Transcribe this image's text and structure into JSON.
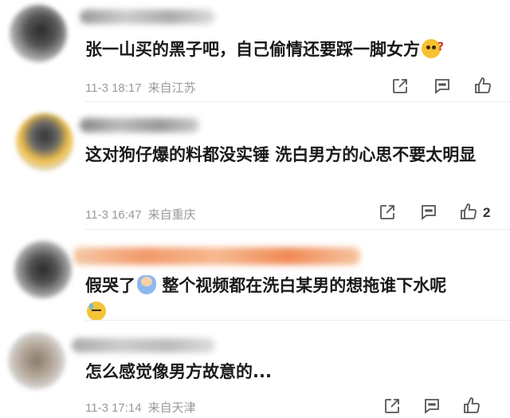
{
  "comments": [
    {
      "text": "张一山买的黑子吧，自己偷情还要踩一脚女方",
      "emoji": "thinking-face",
      "time": "11-3 18:17",
      "location": "来自江苏",
      "likes": ""
    },
    {
      "text": "这对狗仔爆的料都没实锤 洗白男方的心思不要太明显",
      "time": "11-3 16:47",
      "location": "来自重庆",
      "likes": "2"
    },
    {
      "text_a": "假哭了",
      "emoji_a": "baby-face",
      "text_b": "整个视频都在洗白某男的想拖谁下水呢",
      "emoji_b": "sweat-face",
      "time": "",
      "location": ""
    },
    {
      "text": "怎么感觉像男方故意的...",
      "time": "11-3 17:14",
      "location": "来自天津",
      "likes": ""
    }
  ],
  "icons": {
    "share": "share-icon",
    "comment": "comment-icon",
    "like": "thumb-up-icon"
  },
  "colors": {
    "text": "#1a1a1a",
    "meta": "#9a9a9a",
    "icon": "#555555"
  }
}
